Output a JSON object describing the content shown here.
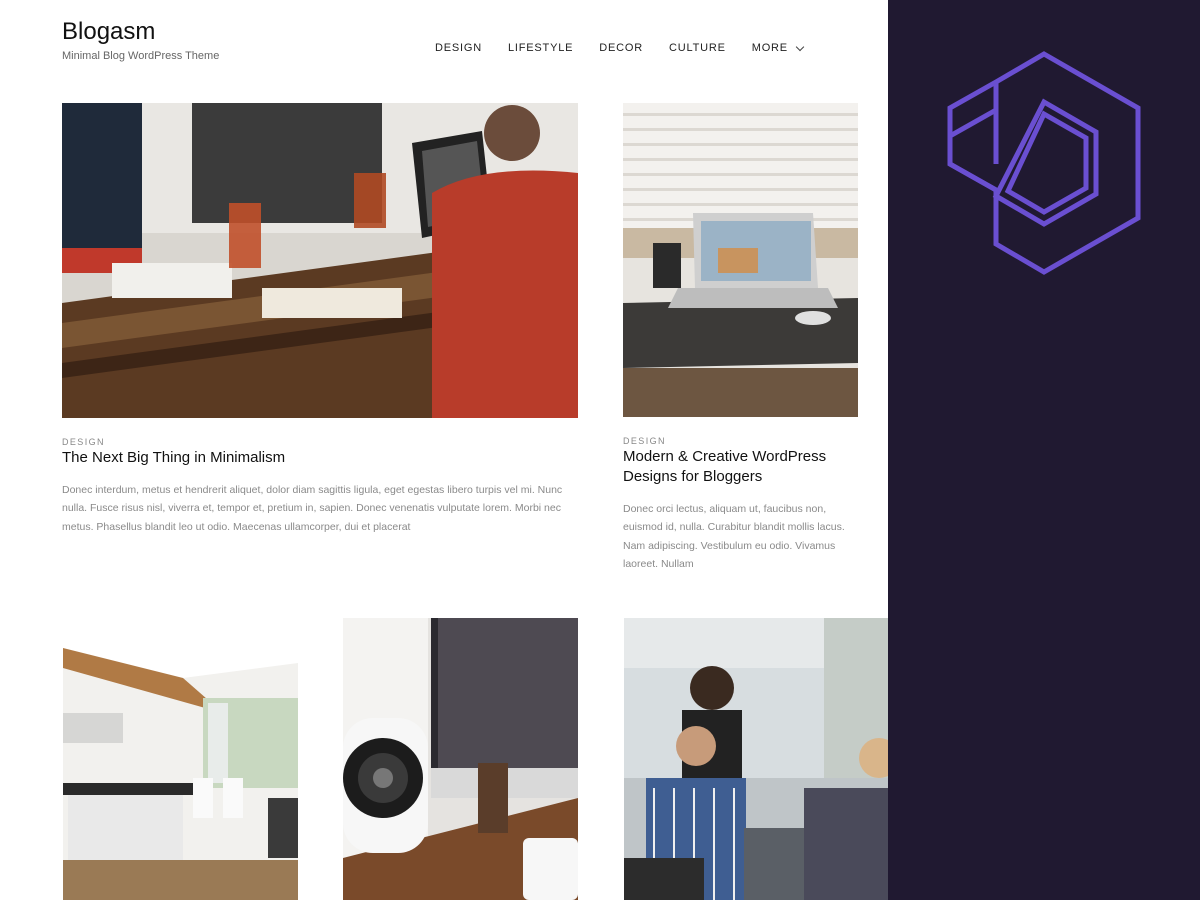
{
  "site": {
    "title": "Blogasm",
    "tagline": "Minimal Blog WordPress Theme"
  },
  "nav": {
    "items": [
      "DESIGN",
      "LIFESTYLE",
      "DECOR",
      "CULTURE"
    ],
    "more_label": "MORE"
  },
  "posts": [
    {
      "category": "DESIGN",
      "title": "The Next Big Thing in Minimalism",
      "excerpt": "Donec interdum, metus et hendrerit aliquet, dolor diam sagittis ligula, eget egestas libero turpis vel mi. Nunc nulla. Fusce risus nisl, viverra et, tempor et, pretium in, sapien. Donec venenatis vulputate lorem. Morbi nec metus. Phasellus blandit leo ut odio. Maecenas ullamcorper, dui et placerat"
    },
    {
      "category": "DESIGN",
      "title": "Modern & Creative WordPress Designs for Bloggers",
      "excerpt": "Donec orci lectus, aliquam ut, faucibus non, euismod id, nulla. Curabitur blandit mollis lacus. Nam adipiscing. Vestibulum eu odio. Vivamus laoreet. Nullam"
    }
  ],
  "colors": {
    "side_panel": "#201931",
    "logo_stroke": "#6a4fd1"
  },
  "icons": {
    "logo": "hexagon-logo-icon",
    "more": "chevron-down-icon"
  }
}
